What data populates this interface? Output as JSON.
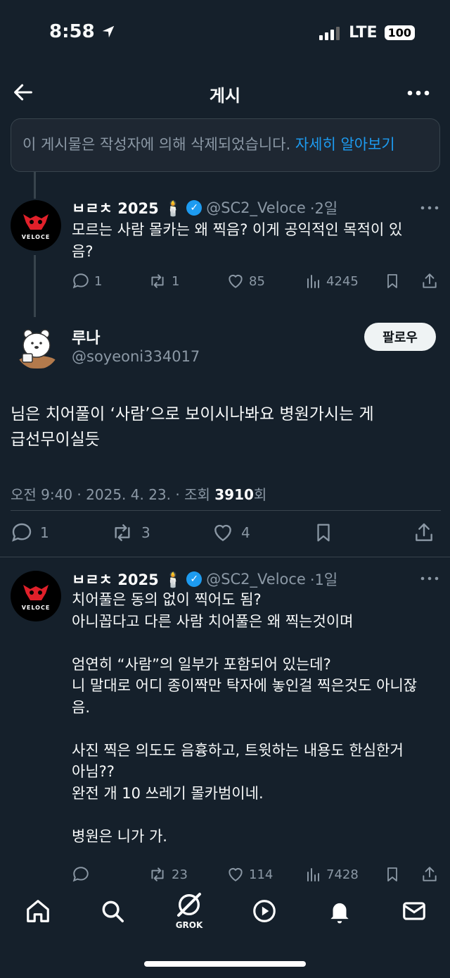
{
  "status_bar": {
    "time": "8:58",
    "network": "LTE",
    "battery": "100"
  },
  "header": {
    "title": "게시"
  },
  "notice": {
    "text": "이 게시물은 작성자에 의해 삭제되었습니다. ",
    "link": "자세히 알아보기"
  },
  "reply_1": {
    "display_name": "ㅂㄹㅊ 2025 🕯️",
    "handle": "@SC2_Veloce",
    "time": "·2일",
    "text_line1": "모르는 사람 몰카는 왜 찍음? 이게 공익적인 목적이 있",
    "text_line2": "음?",
    "avatar_text": "VELOCE",
    "replies": "1",
    "retweets": "1",
    "likes": "85",
    "views": "4245"
  },
  "main_post": {
    "display_name": "루나",
    "handle": "@soyeoni334017",
    "follow_label": "팔로우",
    "text_line1": "님은 치어풀이 ‘사람’으로 보이시나봐요 병원가시는 게",
    "text_line2": "급선무이실듯",
    "meta_prefix": "오전 9:40 · 2025. 4. 23. · 조회 ",
    "meta_views": "3910",
    "meta_suffix": "회",
    "replies": "1",
    "retweets": "3",
    "likes": "4"
  },
  "reply_2": {
    "display_name": "ㅂㄹㅊ 2025 🕯️",
    "handle": "@SC2_Veloce",
    "time": "·1일",
    "avatar_text": "VELOCE",
    "lines": [
      "치어풀은 동의 없이 찍어도 됨?",
      "아니꼽다고 다른 사람 치어풀은 왜 찍는것이며",
      "",
      "엄연히 “사람”의 일부가 포함되어 있는데?",
      "니 말대로 어디 종이짝만 탁자에 놓인걸 찍은것도 아니잖",
      "음.",
      "",
      "사진 찍은 의도도 음흉하고, 트윗하는 내용도 한심한거",
      "아님??",
      "완전 개 10 쓰레기 몰카범이네.",
      "",
      "병원은 니가 가."
    ],
    "retweets": "23",
    "likes": "114",
    "views": "7428"
  },
  "tabbar": {
    "grok_label": "GROK"
  }
}
